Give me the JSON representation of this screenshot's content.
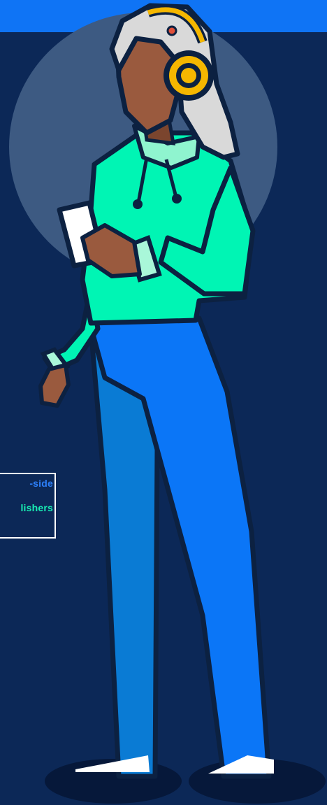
{
  "colors": {
    "background": "#0c2857",
    "top_band": "#0f74f5",
    "circle": "#3d5a82",
    "hoodie": "#00f5b4",
    "pants_front": "#0b76f7",
    "pants_back": "#0a7bd4",
    "skin": "#9a5a3e",
    "hair": "#d9d9d9",
    "headphones": "#f5b700",
    "outline": "#0c2141",
    "label_line_1": "#2d7ff9",
    "label_line_2": "#19f0b4"
  },
  "label": {
    "line_1": "-side",
    "line_2": "lishers"
  },
  "icons": {
    "illustration": "person-with-headphones-and-phone-illustration"
  }
}
